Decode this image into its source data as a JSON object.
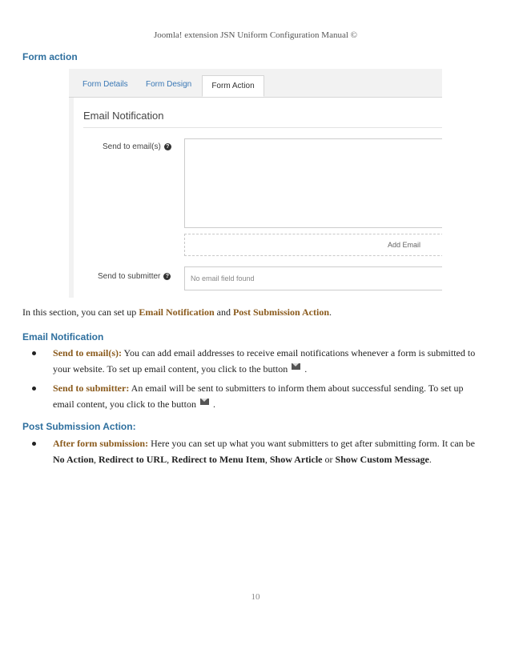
{
  "header": "Joomla! extension JSN Uniform Configuration Manual ©",
  "sections": {
    "form_action": "Form action",
    "email_notification": "Email Notification",
    "post_submission": "Post Submission Action:"
  },
  "screenshot": {
    "tabs": [
      "Form Details",
      "Form Design",
      "Form Action"
    ],
    "panel_title": "Email Notification",
    "send_to_email_label": "Send to email(s)",
    "add_email": "Add Email",
    "send_to_submitter_label": "Send to submitter",
    "no_email_field": "No email field found",
    "help_icon": "question-circle-icon"
  },
  "intro": {
    "before": "In this section, you can set up ",
    "email_notification": "Email Notification",
    "and": " and ",
    "post_submission": "Post Submission Action",
    "end": "."
  },
  "email_items": [
    {
      "term": "Send to email(s):",
      "text1": " You can add email addresses to receive email notifications whenever a form is submitted to your website. To set up email content, you click to the button",
      "text2": "."
    },
    {
      "term": "Send to submitter:",
      "text1": " An email will be sent to submitters to inform them about successful sending.  To set up email content, you click to the button",
      "text2": "."
    }
  ],
  "post_items": [
    {
      "term": "After form submission:",
      "text1": " Here you can set up what you want submitters to get after submitting form. It can be ",
      "opt1": "No Action",
      "sep1": ", ",
      "opt2": "Redirect to URL",
      "sep2": ", ",
      "opt3": "Redirect to Menu Item",
      "sep3": ", ",
      "opt4": "Show Article",
      "or": " or ",
      "opt5": "Show Custom Message",
      "end": "."
    }
  ],
  "page_number": "10"
}
